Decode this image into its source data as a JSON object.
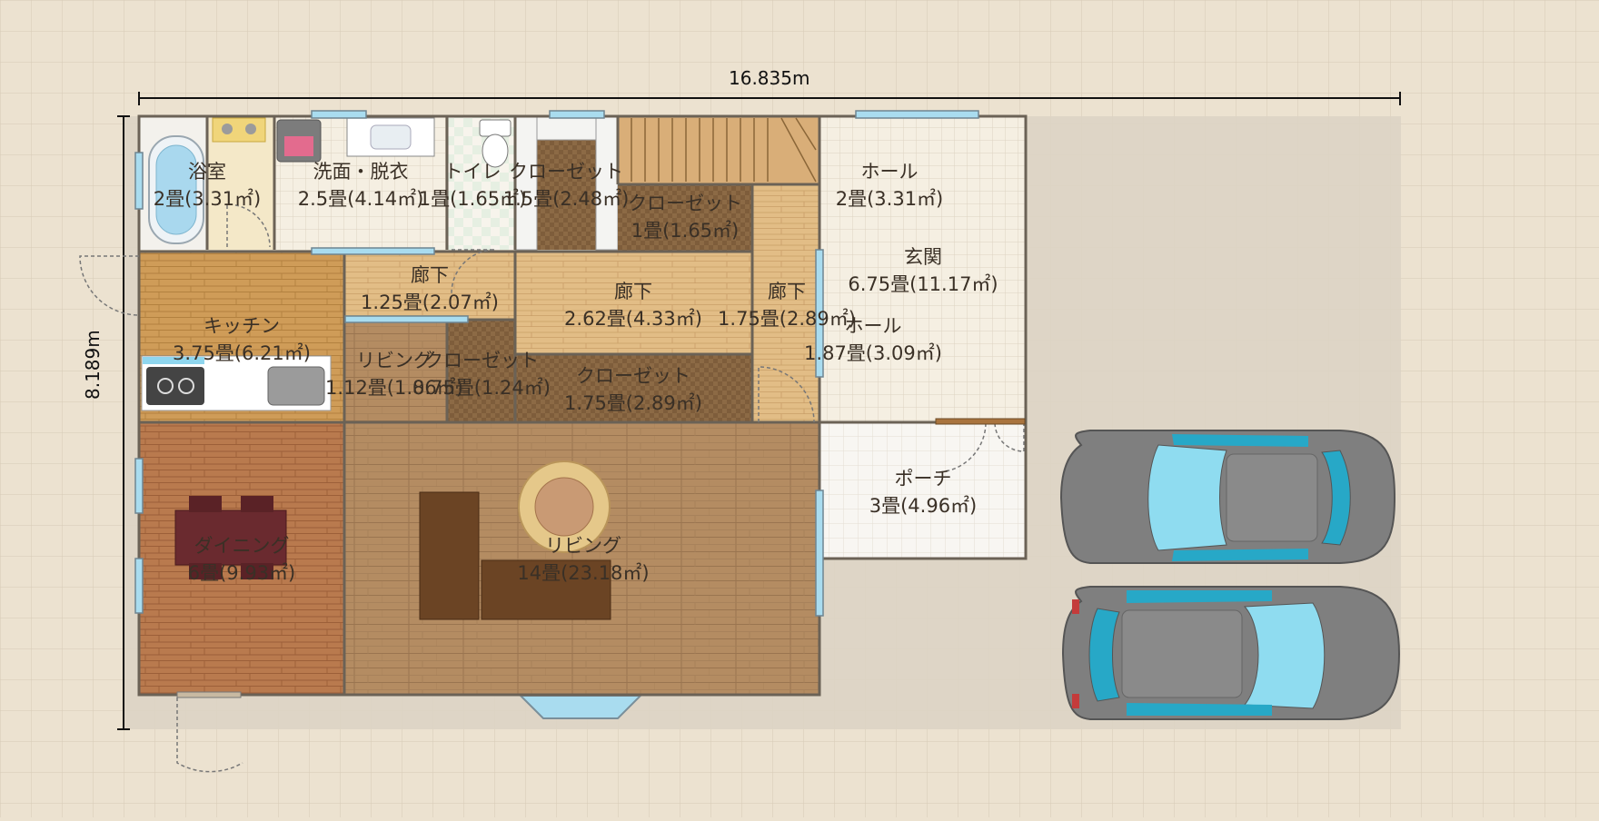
{
  "dimensions": {
    "width_label": "16.835m",
    "height_label": "8.189m"
  },
  "rooms": {
    "bath": {
      "name": "浴室",
      "area": "2畳(3.31㎡)"
    },
    "washroom": {
      "name": "洗面・脱衣",
      "area": "2.5畳(4.14㎡)"
    },
    "toilet": {
      "name": "トイレ",
      "area": "1畳(1.65㎡)"
    },
    "closet_top": {
      "name": "クローゼット",
      "area": "1.5畳(2.48㎡)"
    },
    "closet_mid": {
      "name": "クローゼット",
      "area": "1畳(1.65㎡)"
    },
    "hall_top": {
      "name": "ホール",
      "area": "2畳(3.31㎡)"
    },
    "entrance": {
      "name": "玄関",
      "area": "6.75畳(11.17㎡)"
    },
    "hall_mid": {
      "name": "ホール",
      "area": "1.87畳(3.09㎡)"
    },
    "hallway_a": {
      "name": "廊下",
      "area": "1.25畳(2.07㎡)"
    },
    "hallway_b": {
      "name": "廊下",
      "area": "2.62畳(4.33㎡)"
    },
    "hallway_c": {
      "name": "廊下",
      "area": "1.75畳(2.89㎡)"
    },
    "kitchen": {
      "name": "キッチン",
      "area": "3.75畳(6.21㎡)"
    },
    "living_small": {
      "name": "リビング",
      "area": "1.12畳(1.86㎡)"
    },
    "closet_small": {
      "name": "クローゼット",
      "area": "0.75畳(1.24㎡)"
    },
    "closet_low": {
      "name": "クローゼット",
      "area": "1.75畳(2.89㎡)"
    },
    "porch": {
      "name": "ポーチ",
      "area": "3畳(4.96㎡)"
    },
    "dining": {
      "name": "ダイニング",
      "area": "6畳(9.93㎡)"
    },
    "living": {
      "name": "リビング",
      "area": "14畳(23.18㎡)"
    }
  },
  "colors": {
    "background": "#ece2d0",
    "grid": "#d8ccb8",
    "outside_floor": "#ddd4c4",
    "wall": "#6b6256",
    "wood_floor": "#b08860",
    "kitchen_floor": "#c99a5c",
    "dining_floor": "#b87a52",
    "window": "#a9dcef",
    "car_body": "#7f7f7f",
    "car_glass": "#8fdcf0"
  }
}
